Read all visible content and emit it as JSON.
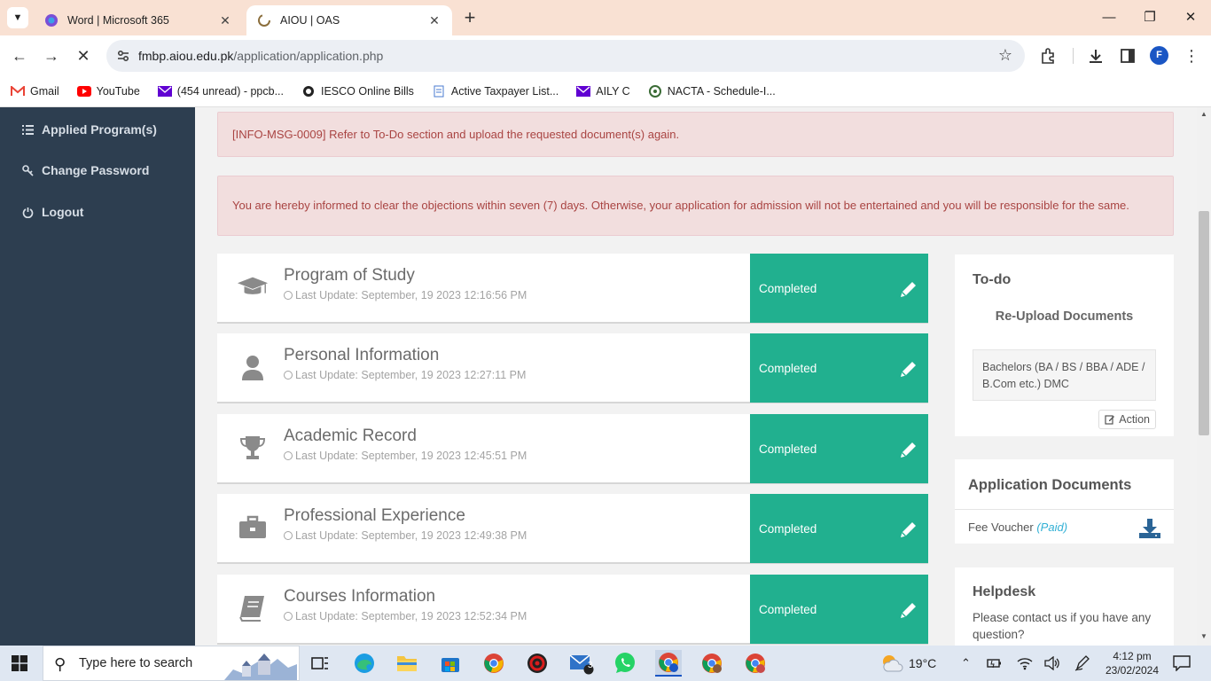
{
  "browser": {
    "tabs": [
      {
        "title": "Word | Microsoft 365",
        "active": false,
        "icon": "microsoft-365-icon"
      },
      {
        "title": "AIOU | OAS",
        "active": true,
        "icon": "aiou-logo-icon"
      }
    ],
    "url_host": "fmbp.aiou.edu.pk",
    "url_path": "/application/application.php",
    "profile_initial": "F",
    "bookmarks": [
      {
        "label": "Gmail",
        "icon": "gmail-icon",
        "color": "#ea4335"
      },
      {
        "label": "YouTube",
        "icon": "youtube-icon",
        "color": "#ff0000"
      },
      {
        "label": "(454 unread) - ppcb...",
        "icon": "yahoo-mail-icon",
        "color": "#6001d2"
      },
      {
        "label": "IESCO Online Bills",
        "icon": "iesco-icon",
        "color": "#222222"
      },
      {
        "label": "Active Taxpayer List...",
        "icon": "document-icon",
        "color": "#4a7bd0"
      },
      {
        "label": "AILY C",
        "icon": "yahoo-mail-icon",
        "color": "#6001d2"
      },
      {
        "label": "NACTA - Schedule-I...",
        "icon": "nacta-icon",
        "color": "#3a6b35"
      }
    ]
  },
  "sidebar": {
    "items": [
      {
        "label": "Applied Program(s)",
        "icon": "list-icon"
      },
      {
        "label": "Change Password",
        "icon": "key-icon"
      },
      {
        "label": "Logout",
        "icon": "power-icon"
      }
    ]
  },
  "alerts": [
    "[INFO-MSG-0009] Refer to To-Do section and upload the requested document(s) again.",
    "You are hereby informed to clear the objections within seven (7) days. Otherwise, your application for admission will not be entertained and you will be responsible for the same."
  ],
  "sections": [
    {
      "title": "Program of Study",
      "updated": "Last Update: September, 19 2023 12:16:56 PM",
      "status": "Completed",
      "icon": "graduation-cap-icon"
    },
    {
      "title": "Personal Information",
      "updated": "Last Update: September, 19 2023 12:27:11 PM",
      "status": "Completed",
      "icon": "user-icon"
    },
    {
      "title": "Academic Record",
      "updated": "Last Update: September, 19 2023 12:45:51 PM",
      "status": "Completed",
      "icon": "trophy-icon"
    },
    {
      "title": "Professional Experience",
      "updated": "Last Update: September, 19 2023 12:49:38 PM",
      "status": "Completed",
      "icon": "briefcase-icon"
    },
    {
      "title": "Courses Information",
      "updated": "Last Update: September, 19 2023 12:52:34 PM",
      "status": "Completed",
      "icon": "book-icon"
    }
  ],
  "todo": {
    "heading": "To-do",
    "subheading": "Re-Upload Documents",
    "item": "Bachelors (BA / BS / BBA / ADE / B.Com etc.) DMC",
    "action_label": "Action"
  },
  "app_docs": {
    "heading": "Application Documents",
    "item_label": "Fee Voucher",
    "item_status": "(Paid)"
  },
  "helpdesk": {
    "heading": "Helpdesk",
    "text": "Please contact us if you have any question?"
  },
  "taskbar": {
    "search_placeholder": "Type here to search",
    "weather": "19°C",
    "time": "4:12 pm",
    "date": "23/02/2024",
    "mail_badge": "3"
  },
  "colors": {
    "sidebar_bg": "#2d3e50",
    "completed": "#21b08f",
    "alert_bg": "#f2dede",
    "alert_text": "#a94442"
  }
}
